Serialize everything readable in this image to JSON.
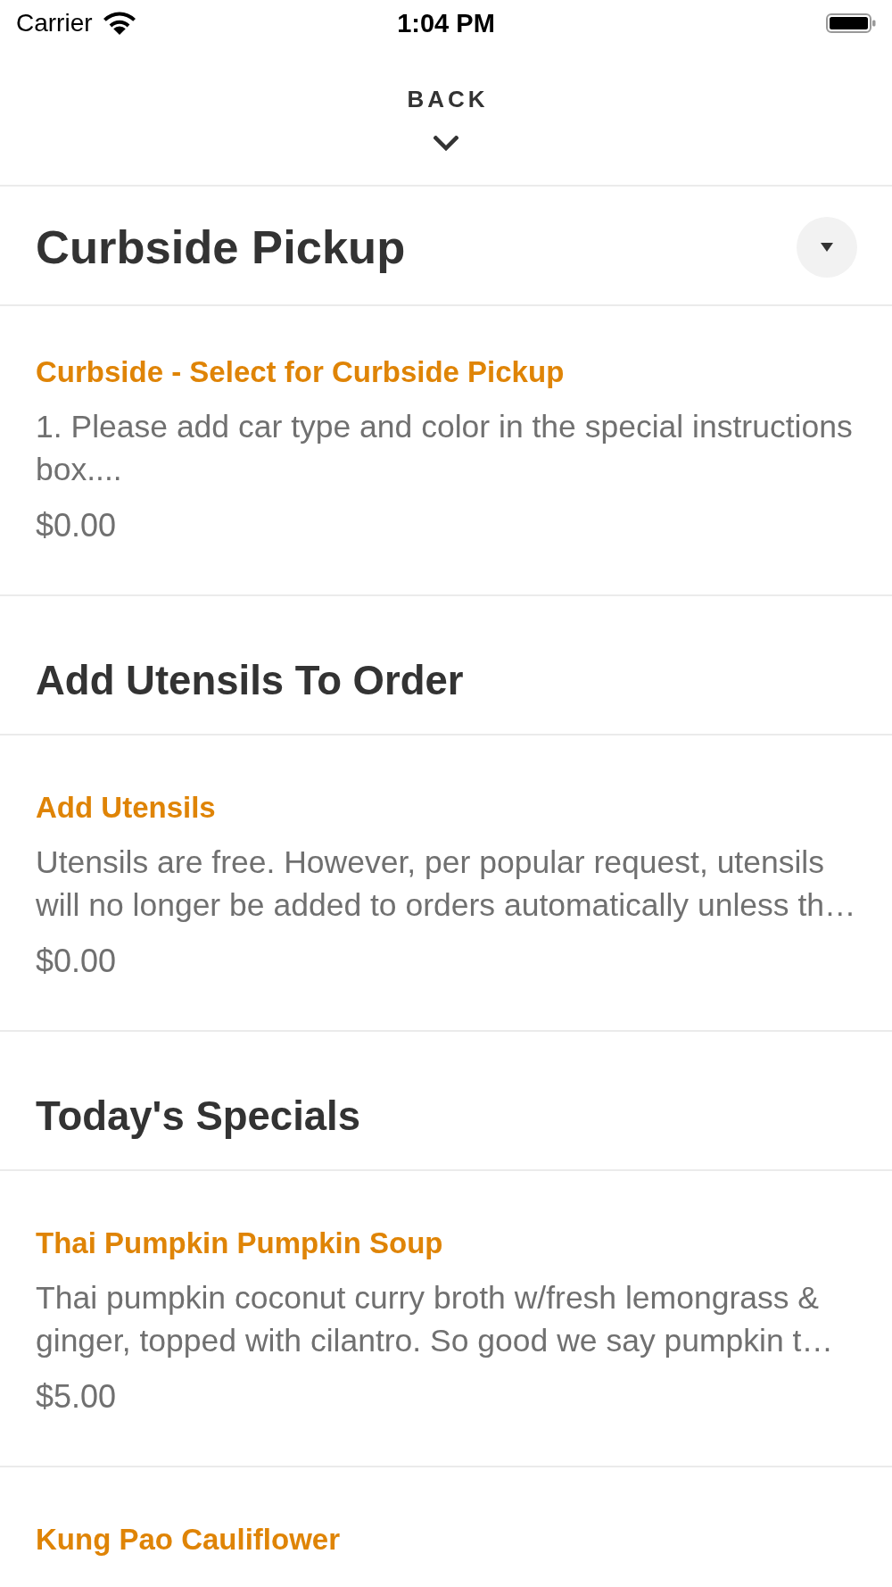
{
  "status_bar": {
    "carrier": "Carrier",
    "time": "1:04 PM"
  },
  "nav": {
    "back_label": "BACK"
  },
  "sections": [
    {
      "kind": "category",
      "title": "Curbside Pickup",
      "items": [
        {
          "name": "Curbside - Select for Curbside Pickup",
          "description": "1. Please add car type and color in the special instructions box....",
          "price": "$0.00"
        }
      ]
    },
    {
      "kind": "group",
      "title": "Add Utensils To Order",
      "items": [
        {
          "name": "Add Utensils",
          "description": "Utensils are free. However, per popular request, utensils will no longer be added to orders automatically unless th…",
          "price": "$0.00"
        }
      ]
    },
    {
      "kind": "group",
      "title": "Today's Specials",
      "items": [
        {
          "name": "Thai Pumpkin Pumpkin Soup",
          "description": "Thai pumpkin coconut curry broth w/fresh lemongrass & ginger, topped with cilantro. So good we say pumpkin t…",
          "price": "$5.00"
        },
        {
          "name": "Kung Pao Cauliflower"
        }
      ]
    }
  ]
}
